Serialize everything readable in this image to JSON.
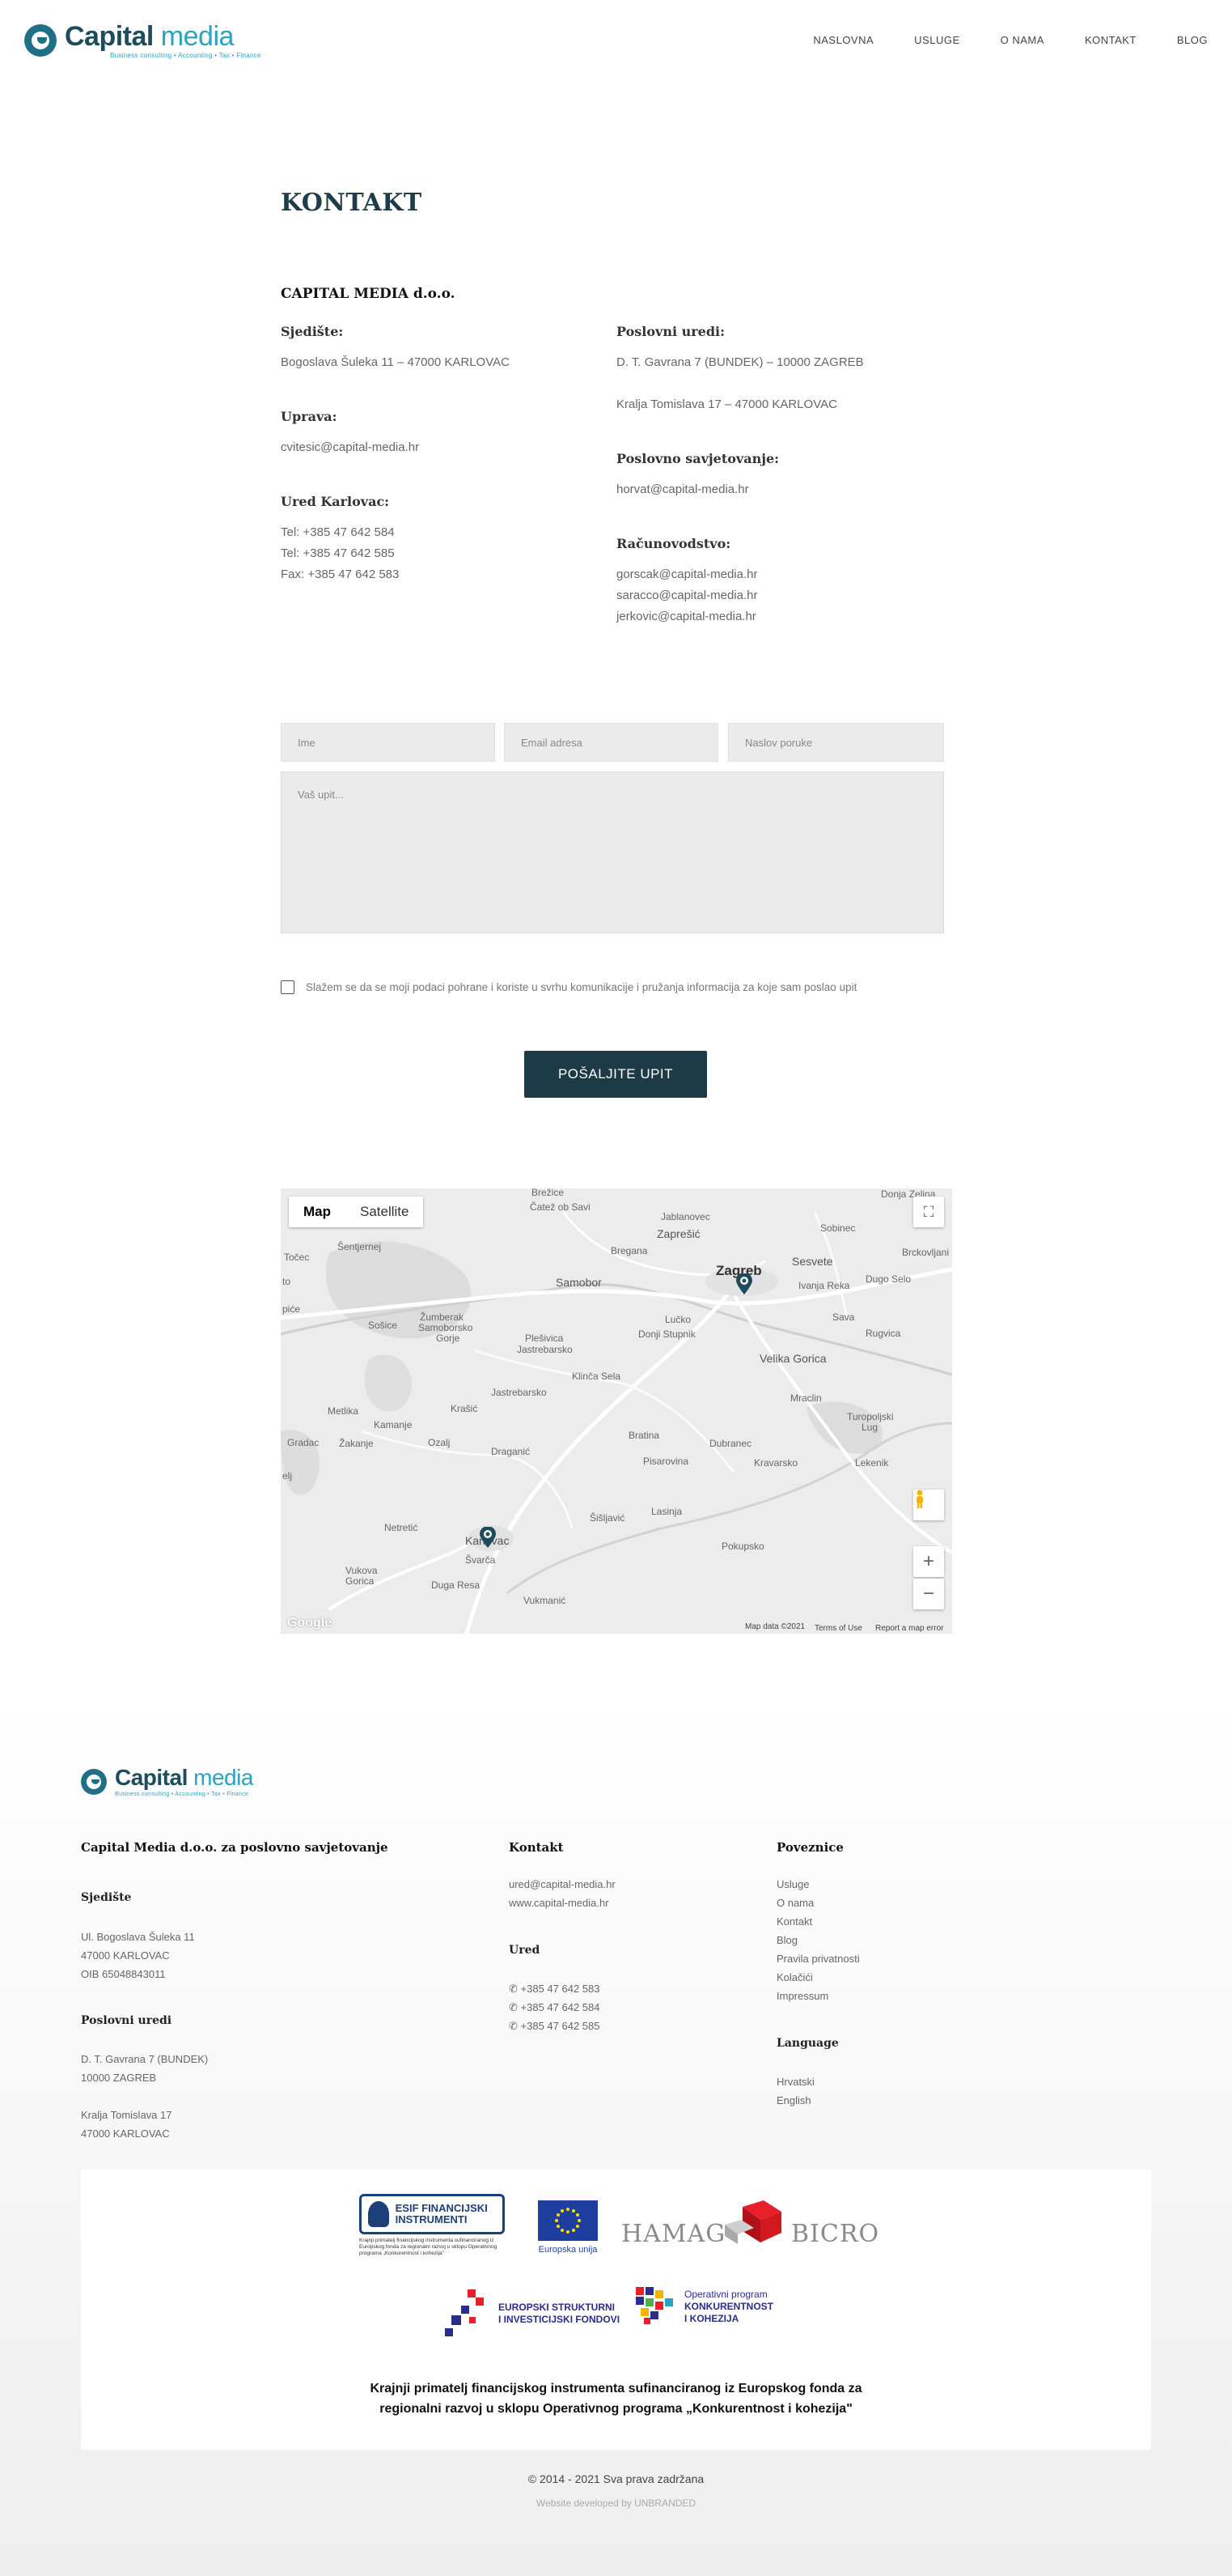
{
  "header": {
    "logo_name_bold": "Capital",
    "logo_name_light": " media",
    "logo_tagline": "Business consulting • Accounting • Tax • Finance",
    "nav": [
      "NASLOVNA",
      "USLUGE",
      "O NAMA",
      "KONTAKT",
      "BLOG"
    ]
  },
  "contact": {
    "title": "KONTAKT",
    "company": "CAPITAL MEDIA d.o.o.",
    "sjediste_label": "Sjedište:",
    "sjediste_value": "Bogoslava Šuleka 11 – 47000 KARLOVAC",
    "uprava_label": "Uprava:",
    "uprava_value": "cvitesic@capital-media.hr",
    "ured_label": "Ured Karlovac:",
    "ured_lines": [
      "Tel: +385 47 642 584",
      "Tel: +385 47 642 585",
      "Fax: +385 47 642 583"
    ],
    "poslovni_label": "Poslovni uredi:",
    "poslovni_lines": [
      "D. T. Gavrana 7 (BUNDEK) – 10000 ZAGREB",
      "Kralja Tomislava 17 –  47000 KARLOVAC"
    ],
    "savjetovanje_label": "Poslovno savjetovanje:",
    "savjetovanje_value": "horvat@capital-media.hr",
    "racunovodstvo_label": "Računovodstvo:",
    "racunovodstvo_lines": [
      "gorscak@capital-media.hr",
      "saracco@capital-media.hr",
      "jerkovic@capital-media.hr"
    ]
  },
  "form": {
    "name_placeholder": "Ime",
    "email_placeholder": "Email adresa",
    "subject_placeholder": "Naslov poruke",
    "message_placeholder": "Vaš upit...",
    "consent_text": "Slažem se da se moji podaci pohrane  i koriste u svrhu komunikacije i pružanja informacija za koje sam poslao upit",
    "submit_label": "POŠALJITE UPIT"
  },
  "map": {
    "map_tab": "Map",
    "satellite_tab": "Satellite",
    "labels": {
      "zagreb": "Zagreb",
      "zapresic": "Zaprešić",
      "samobor": "Samobor",
      "velika_gorica": "Velika Gorica",
      "karlovac": "Karlovac",
      "sesvete": "Sesvete",
      "jastrebarsko": "Jastrebarsko",
      "klinca_sela": "Klinča Sela",
      "brezice": "Brežice",
      "cacak": "Čatež ob Savi",
      "jablanovec": "Jablanovec",
      "sentjernej": "Šentjernej",
      "sobinec": "Sobinec",
      "dubrava": "Donja Zelina",
      "brckovljani": "Brckovljani",
      "dugo_selo": "Dugo Selo",
      "rugvica": "Rugvica",
      "ivanja_reka": "Ivanja Reka",
      "sosice": "Sošice",
      "zumberak": "Žumberak",
      "zumberak2": "Samoborsko",
      "zumberak3": "Gorje",
      "plesivica": "Plešivica",
      "jastrebarsko2": "Jastrebarsko",
      "lucko": "Lučko",
      "donji_stupnik": "Donji Stupnik",
      "bregana": "Bregana",
      "mraclin": "Mraclin",
      "turopoljski": "Turopoljski",
      "lug": "Lug",
      "metlika": "Metlika",
      "kamanje": "Kamanje",
      "krasic": "Krašić",
      "gradac": "Gradac",
      "zakanje": "Žakanje",
      "ozalj": "Ozalj",
      "draganic": "Draganić",
      "bratina": "Bratina",
      "dubranec": "Dubranec",
      "pisarovina": "Pisarovina",
      "kravarsko": "Kravarsko",
      "lekenik": "Lekenik",
      "netretic": "Netretić",
      "sisljavic": "Šišljavić",
      "lasinja": "Lasinja",
      "pokupsko": "Pokupsko",
      "svarca": "Švarča",
      "vukova_gorica": "Vukova",
      "vukova_gorica2": "Gorica",
      "duga_resa": "Duga Resa",
      "vukmanic": "Vukmanić",
      "tocec": "Točec",
      "pice": "piće",
      "sava": "Sava",
      "to": "to",
      "elj": "elj",
      "rbs": "Brezice"
    },
    "footer_data": "Map data ©2021",
    "footer_terms": "Terms of Use",
    "footer_report": "Report a map error",
    "google": "Google"
  },
  "footer": {
    "logo_name_bold": "Capital",
    "logo_name_light": " media",
    "logo_tagline": "Business consulting • Accounting • Tax • Finance",
    "company": "Capital Media d.o.o. za poslovno savjetovanje",
    "sjediste_label": "Sjedište",
    "sjediste_lines": [
      "Ul. Bogoslava Šuleka 11",
      "47000 KARLOVAC",
      "OIB 65048843011"
    ],
    "poslovni_label": "Poslovni uredi",
    "poslovni_lines": [
      "D. T. Gavrana 7 (BUNDEK)",
      "10000 ZAGREB",
      "",
      "Kralja Tomislava 17",
      "47000 KARLOVAC"
    ],
    "kontakt_label": "Kontakt",
    "kontakt_lines": [
      "ured@capital-media.hr",
      "www.capital-media.hr"
    ],
    "ured_label": "Ured",
    "ured_phones": [
      "+385 47 642 583",
      "+385 47 642 584",
      "+385 47 642 585"
    ],
    "poveznice_label": "Poveznice",
    "poveznice": [
      "Usluge",
      "O nama",
      "Kontakt",
      "Blog",
      "Pravila privatnosti",
      "Kolačići",
      "Impressum"
    ],
    "language_label": "Language",
    "languages": [
      "Hrvatski",
      "English"
    ]
  },
  "sponsors": {
    "esif_title": "ESIF FINANCIJSKI INSTRUMENTI",
    "esif_small": "Krajnji primatelj financijskog instrumenta sufinanciranog iz Europskog fonda za regionalni razvoj u sklopu Operativnog programa „Konkurentnost i kohezija\"",
    "eu_label": "Europska unija",
    "hamag_left": "HAMAG",
    "hamag_right": "BICRO",
    "esf_line1": "EUROPSKI STRUKTURNI",
    "esf_line2": "I INVESTICIJSKI FONDOVI",
    "opk_line1": "Operativni program",
    "opk_line2": "KONKURENTNOST",
    "opk_line3": "I KOHEZIJA",
    "statement_line1": "Krajnji primatelj financijskog instrumenta sufinanciranog iz Europskog fonda za",
    "statement_line2": "regionalni razvoj u sklopu Operativnog programa „Konkurentnost i kohezija\""
  },
  "copyright": "© 2014 - 2021 Sva prava zadržana",
  "credit": "Website developed by UNBRANDED",
  "colors": {
    "primary": "#1c3b47",
    "accent": "#2aa3c0",
    "field_bg": "#ebebeb",
    "map_bg": "#e9e9e9"
  }
}
